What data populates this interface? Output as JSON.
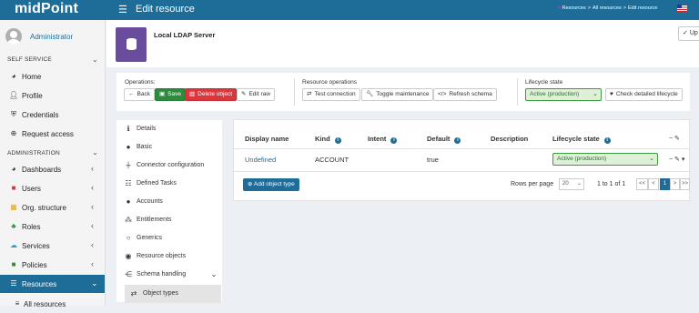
{
  "header": {
    "logo": "midPoint",
    "title": "Edit resource",
    "breadcrumb": [
      "Resources",
      "All resources",
      "Edit resource"
    ]
  },
  "sidebar": {
    "user": "Administrator",
    "self_service_label": "SELF SERVICE",
    "self_service_items": [
      {
        "label": "Home",
        "icon": "dashboard-icon"
      },
      {
        "label": "Profile",
        "icon": "user-icon"
      },
      {
        "label": "Credentials",
        "icon": "shield-icon"
      },
      {
        "label": "Request access",
        "icon": "plus-circle-icon"
      }
    ],
    "admin_label": "ADMINISTRATION",
    "admin_items": [
      {
        "label": "Dashboards",
        "icon": "dashboard-icon"
      },
      {
        "label": "Users",
        "icon": "user-icon"
      },
      {
        "label": "Org. structure",
        "icon": "org-icon"
      },
      {
        "label": "Roles",
        "icon": "roles-icon"
      },
      {
        "label": "Services",
        "icon": "cloud-icon"
      },
      {
        "label": "Policies",
        "icon": "policies-icon"
      },
      {
        "label": "Resources",
        "icon": "database-icon"
      },
      {
        "label": "All resources",
        "icon": "list-icon"
      }
    ]
  },
  "resource": {
    "name": "Local LDAP Server",
    "top_right_button": "Up"
  },
  "toolbar": {
    "operations_label": "Operations:",
    "back": "Back",
    "save": "Save",
    "delete": "Delete object",
    "edit_raw": "Edit raw",
    "resource_ops_label": "Resource operations",
    "test_connection": "Test connection",
    "toggle_maintenance": "Toggle maintenance",
    "refresh_schema": "Refresh schema",
    "lifecycle_label": "Lifecycle state",
    "lifecycle_value": "Active (production)",
    "check_lifecycle": "Check detailed lifecycle"
  },
  "menu": [
    {
      "label": "Details",
      "icon": "info-icon"
    },
    {
      "label": "Basic",
      "icon": "circle-icon"
    },
    {
      "label": "Connector configuration",
      "icon": "plug-icon"
    },
    {
      "label": "Defined Tasks",
      "icon": "tasks-icon"
    },
    {
      "label": "Accounts",
      "icon": "user-icon"
    },
    {
      "label": "Entitlements",
      "icon": "users-icon"
    },
    {
      "label": "Generics",
      "icon": "circle-outline-icon"
    },
    {
      "label": "Resource objects",
      "icon": "eye-icon"
    },
    {
      "label": "Schema handling",
      "icon": "share-icon"
    },
    {
      "label": "Object types",
      "icon": "exchange-icon"
    }
  ],
  "table": {
    "columns": [
      "Display name",
      "Kind",
      "Intent",
      "Default",
      "Description",
      "Lifecycle state"
    ],
    "rows": [
      {
        "display_name": "Undefined",
        "kind": "ACCOUNT",
        "intent": "",
        "default": "true",
        "description": "",
        "lifecycle": "Active (production)"
      }
    ],
    "add_button": "Add object type",
    "rows_per_page_label": "Rows per page",
    "rows_per_page": "20",
    "range": "1 to 1 of 1",
    "pages": [
      "<<",
      "<",
      "1",
      ">",
      ">>"
    ]
  },
  "colors": {
    "header": "#1e6d98",
    "save": "#2e8b3e",
    "delete": "#d9363e",
    "resource_icon": "#6a4c9c"
  }
}
